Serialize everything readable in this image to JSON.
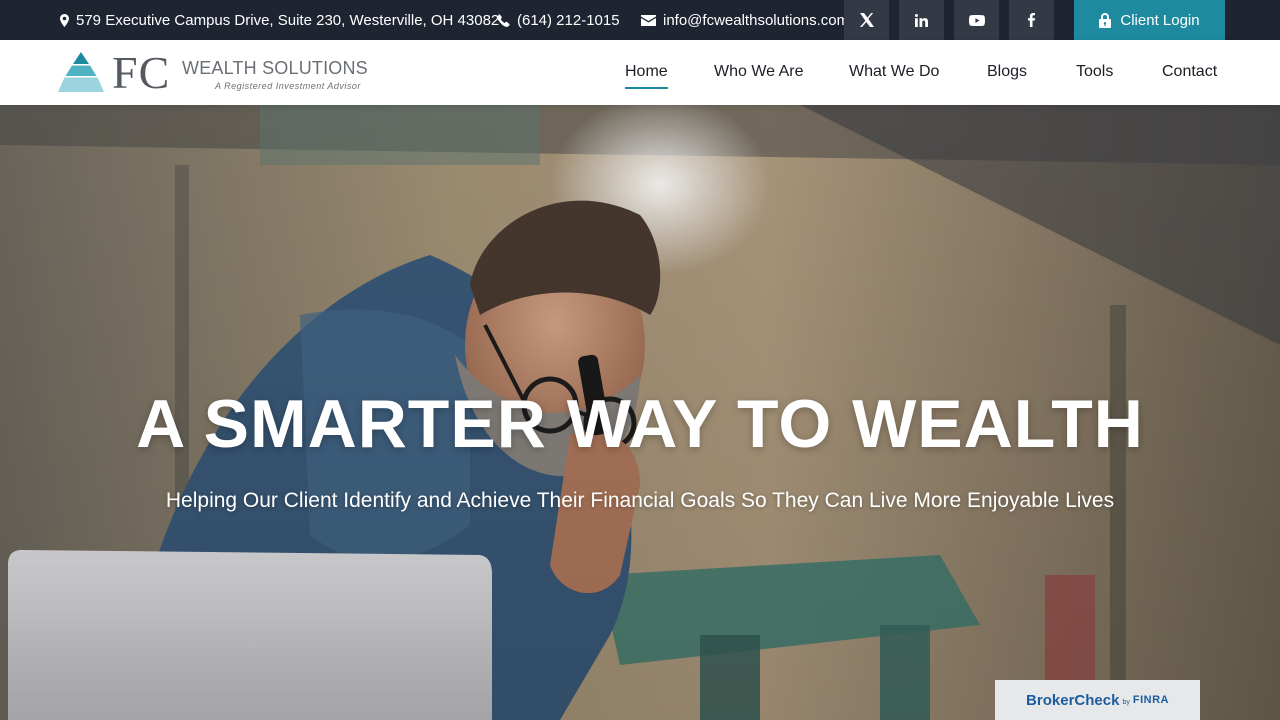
{
  "topbar": {
    "address": "579 Executive Campus Drive, Suite 230, Westerville, OH 43082",
    "phone": "(614) 212-1015",
    "email": "info@fcwealthsolutions.com",
    "social": [
      "x-twitter-icon",
      "linkedin-icon",
      "youtube-icon",
      "facebook-icon"
    ],
    "client_login": "Client Login"
  },
  "logo": {
    "initials": "FC",
    "name": "WEALTH SOLUTIONS",
    "tagline": "A Registered Investment Advisor"
  },
  "nav": {
    "items": [
      "Home",
      "Who We Are",
      "What We Do",
      "Blogs",
      "Tools",
      "Contact"
    ],
    "active": "Home"
  },
  "hero": {
    "title": "A SMARTER WAY TO WEALTH",
    "subtitle": "Helping Our Client Identify and Achieve Their Financial Goals So They Can Live More Enjoyable Lives"
  },
  "brokercheck": {
    "main": "BrokerCheck",
    "by": "by",
    "finra": "FINRA"
  },
  "colors": {
    "topbar_bg": "#1e2430",
    "social_bg": "#333945",
    "accent": "#1e8a9f",
    "nav_text": "#1b1f26"
  }
}
